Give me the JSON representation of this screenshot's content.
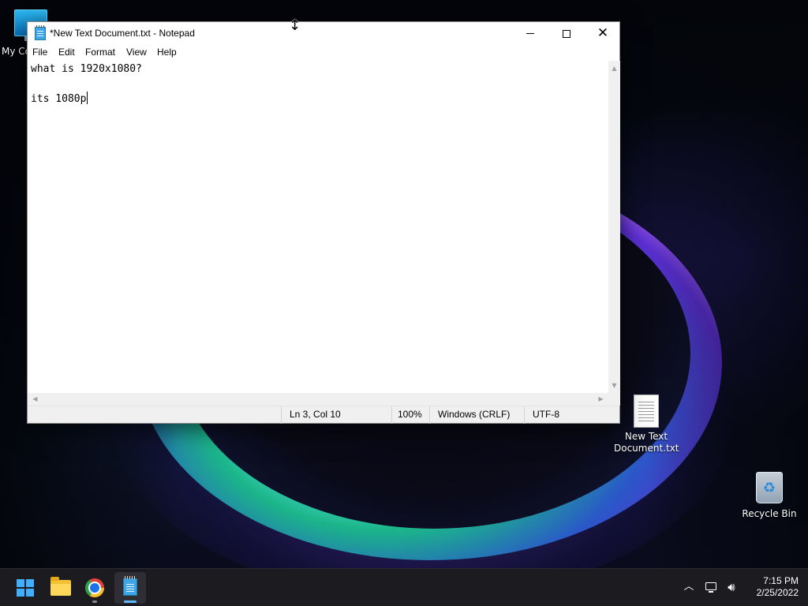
{
  "desktop": {
    "icons": [
      {
        "label": "My Co",
        "icon": "computer-icon"
      },
      {
        "label_line1": "New Text",
        "label_line2": "Document.txt",
        "icon": "text-document-icon"
      },
      {
        "label": "Recycle Bin",
        "icon": "recycle-bin-icon"
      }
    ]
  },
  "notepad": {
    "title": "*New Text Document.txt - Notepad",
    "menu": [
      "File",
      "Edit",
      "Format",
      "View",
      "Help"
    ],
    "content": {
      "line1": "what is 1920x1080?",
      "line2": "",
      "line3": "its 1080p"
    },
    "status": {
      "position": "Ln 3, Col 10",
      "zoom": "100%",
      "line_ending": "Windows (CRLF)",
      "encoding": "UTF-8"
    }
  },
  "taskbar": {
    "apps": [
      "start-icon",
      "file-explorer-icon",
      "chrome-icon",
      "notepad-icon"
    ],
    "clock": {
      "time": "7:15 PM",
      "date": "2/25/2022"
    }
  },
  "colors": {
    "accent": "#60b8ff",
    "taskbar_bg": "#1c1c20",
    "window_bg": "#ffffff"
  }
}
